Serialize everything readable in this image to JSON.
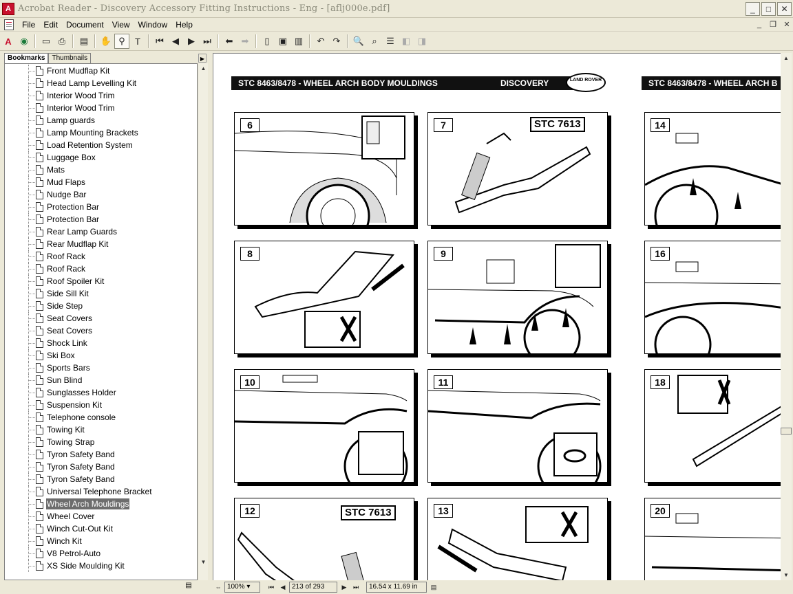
{
  "window": {
    "title": "Acrobat Reader - Discovery Accessory Fitting Instructions - Eng - [aflj000e.pdf]",
    "controls": [
      "_",
      "□",
      "✕"
    ]
  },
  "menu": {
    "items": [
      "File",
      "Edit",
      "Document",
      "View",
      "Window",
      "Help"
    ],
    "mdi_controls": [
      "_",
      "❐",
      "✕"
    ]
  },
  "toolbar": {
    "icons": [
      "acrobat-logo-icon",
      "web-capture-icon",
      "open-icon",
      "print-icon",
      "show-navigation-icon",
      "hand-tool-icon",
      "zoom-tool-icon",
      "text-select-icon",
      "first-page-icon",
      "previous-page-icon",
      "next-page-icon",
      "last-page-icon",
      "go-back-icon",
      "go-forward-icon",
      "actual-size-icon",
      "fit-page-icon",
      "fit-width-icon",
      "rotate-left-icon",
      "rotate-right-icon",
      "find-icon",
      "search-icon",
      "search-results-icon",
      "previous-highlight-icon",
      "next-highlight-icon"
    ]
  },
  "navigation": {
    "tabs": [
      "Bookmarks",
      "Thumbnails"
    ],
    "bookmarks": [
      "Front Mudflap Kit",
      "Head Lamp Levelling Kit",
      "Interior Wood Trim",
      "Interior Wood Trim",
      "Lamp guards",
      "Lamp Mounting Brackets",
      "Load Retention System",
      "Luggage Box",
      "Mats",
      "Mud Flaps",
      "Nudge Bar",
      "Protection Bar",
      "Protection Bar",
      "Rear Lamp Guards",
      "Rear Mudflap Kit",
      "Roof Rack",
      "Roof Rack",
      "Roof Spoiler Kit",
      "Side Sill Kit",
      "Side Step",
      "Seat Covers",
      "Seat Covers",
      "Shock Link",
      "Ski Box",
      "Sports Bars",
      "Sun Blind",
      "Sunglasses Holder",
      "Suspension Kit",
      "Telephone console",
      "Towing Kit",
      "Towing Strap",
      "Tyron Safety Band",
      "Tyron Safety Band",
      "Tyron Safety Band",
      "Universal Telephone Bracket",
      "Wheel Arch Mouldings",
      "Wheel Cover",
      "Winch Cut-Out Kit",
      "Winch Kit",
      "V8 Petrol-Auto",
      "XS Side Moulding Kit"
    ],
    "selected": "Wheel Arch Mouldings"
  },
  "document": {
    "page_left": {
      "header": "STC 8463/8478 - WHEEL ARCH BODY MOULDINGS",
      "model": "DISCOVERY",
      "logo": "LAND ROVER",
      "steps": [
        "6",
        "7",
        "8",
        "9",
        "10",
        "11",
        "12",
        "13"
      ],
      "tool_callouts": [
        "STC 7613",
        "STC 7613"
      ]
    },
    "page_right": {
      "header": "STC 8463/8478 - WHEEL ARCH B",
      "steps": [
        "14",
        "16",
        "18",
        "20"
      ]
    }
  },
  "status": {
    "zoom": "100%",
    "page": "213 of 293",
    "page_size": "16.54 x 11.69 in"
  },
  "colors": {
    "chrome": "#ece9d8",
    "selection": "#6d6d6d",
    "acrobat_red": "#c8102e"
  }
}
